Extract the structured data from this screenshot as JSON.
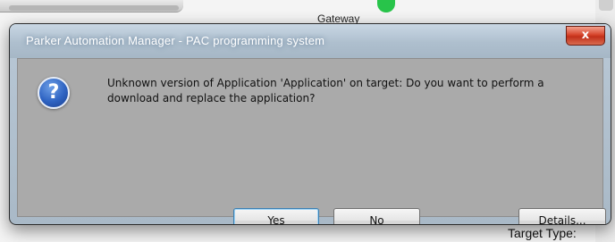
{
  "background": {
    "top_label": "Gateway",
    "bottom_label": "Target Type:"
  },
  "dialog": {
    "title": "Parker Automation Manager - PAC programming system",
    "close_glyph": "x",
    "icon": "question-icon",
    "icon_glyph": "?",
    "message_line1": "Unknown version of Application 'Application' on target: Do you want to perform a",
    "message_line2": "download and replace the application?",
    "buttons": {
      "yes": "Yes",
      "no": "No",
      "details": "Details..."
    }
  },
  "colors": {
    "close_button": "#d6452c",
    "icon_blue": "#2e63c2",
    "focus_border": "#3c7fb1"
  }
}
